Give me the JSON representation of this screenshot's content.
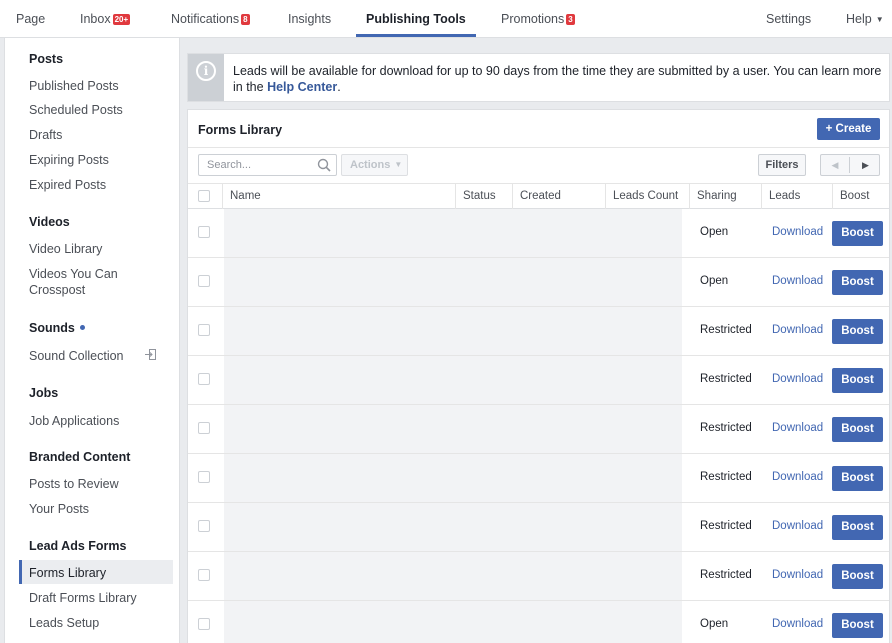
{
  "topnav": {
    "page": "Page",
    "inbox": "Inbox",
    "inbox_badge": "20+",
    "notifications": "Notifications",
    "notifications_badge": "8",
    "insights": "Insights",
    "publishing_tools": "Publishing Tools",
    "promotions": "Promotions",
    "promotions_badge": "3",
    "settings": "Settings",
    "help": "Help"
  },
  "sidebar": {
    "posts_header": "Posts",
    "published_posts": "Published Posts",
    "scheduled_posts": "Scheduled Posts",
    "drafts": "Drafts",
    "expiring_posts": "Expiring Posts",
    "expired_posts": "Expired Posts",
    "videos_header": "Videos",
    "video_library": "Video Library",
    "videos_crosspost_1": "Videos You Can",
    "videos_crosspost_2": "Crosspost",
    "sounds_header": "Sounds",
    "sound_collection": "Sound Collection",
    "jobs_header": "Jobs",
    "job_applications": "Job Applications",
    "branded_header": "Branded Content",
    "posts_to_review": "Posts to Review",
    "your_posts": "Your Posts",
    "lead_ads_header": "Lead Ads Forms",
    "forms_library": "Forms Library",
    "draft_forms_library": "Draft Forms Library",
    "leads_setup": "Leads Setup"
  },
  "banner": {
    "text": "Leads will be available for download for up to 90 days from the time they are submitted by a user. You can learn more in the ",
    "link": "Help Center",
    "end": "."
  },
  "forms": {
    "title": "Forms Library",
    "create_label": "+ Create",
    "search_placeholder": "Search...",
    "actions_label": "Actions",
    "filters_label": "Filters",
    "columns": {
      "name": "Name",
      "status": "Status",
      "created": "Created",
      "leads_count": "Leads Count",
      "sharing": "Sharing",
      "leads": "Leads",
      "boost": "Boost"
    },
    "rows": [
      {
        "sharing": "Open",
        "leads": "Download",
        "boost": "Boost"
      },
      {
        "sharing": "Open",
        "leads": "Download",
        "boost": "Boost"
      },
      {
        "sharing": "Restricted",
        "leads": "Download",
        "boost": "Boost"
      },
      {
        "sharing": "Restricted",
        "leads": "Download",
        "boost": "Boost"
      },
      {
        "sharing": "Restricted",
        "leads": "Download",
        "boost": "Boost"
      },
      {
        "sharing": "Restricted",
        "leads": "Download",
        "boost": "Boost"
      },
      {
        "sharing": "Restricted",
        "leads": "Download",
        "boost": "Boost"
      },
      {
        "sharing": "Restricted",
        "leads": "Download",
        "boost": "Boost"
      },
      {
        "sharing": "Open",
        "leads": "Download",
        "boost": "Boost"
      }
    ]
  },
  "colors": {
    "accent": "#4267b2",
    "badge": "#e0393e"
  }
}
